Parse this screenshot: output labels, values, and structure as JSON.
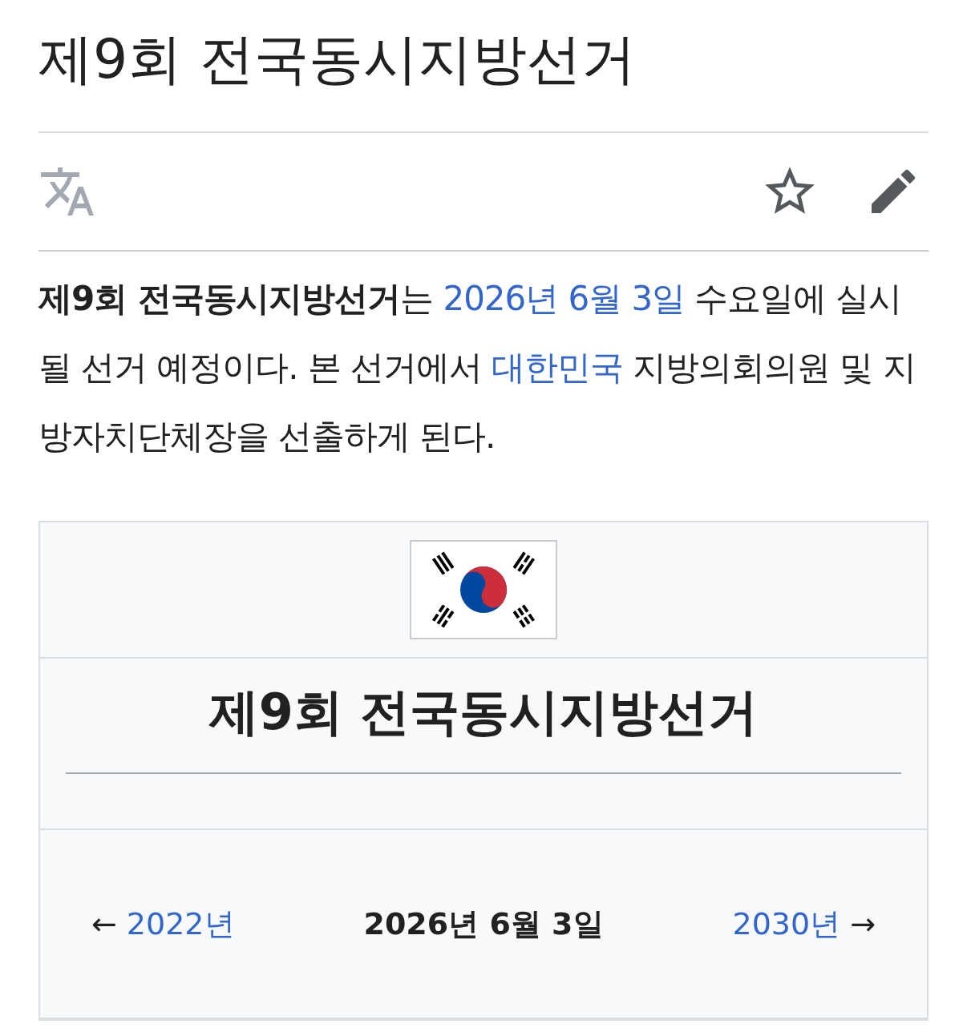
{
  "title": "제9회 전국동시지방선거",
  "intro": [
    {
      "kind": "bold",
      "text": "제9회 전국동시지방선거"
    },
    {
      "kind": "plain",
      "text": "는 "
    },
    {
      "kind": "link",
      "text": "2026년 6월 3일"
    },
    {
      "kind": "plain",
      "text": " 수요일에 실시될 선거 예정이다. 본 선거에서 "
    },
    {
      "kind": "link",
      "text": "대한민국"
    },
    {
      "kind": "plain",
      "text": " 지방의회의원 및 지방자치단체장을 선출하게 된다."
    }
  ],
  "infobox": {
    "title": "제9회 전국동시지방선거",
    "previous": {
      "arrow": "←",
      "label": "2022년"
    },
    "current": "2026년 6월 3일",
    "next": {
      "label": "2030년",
      "arrow": "→"
    }
  }
}
